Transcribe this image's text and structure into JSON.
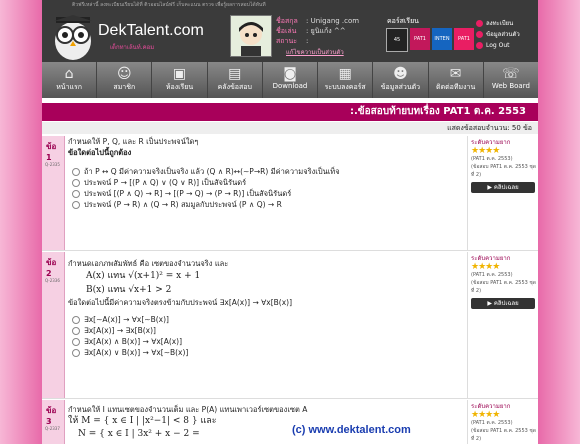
{
  "top_strip": "ติวฟรีเหล่านี้ ลงทะเบียนเรียนได้ที่ ติวออนไลน์ฟรี เก็บคะแนน ตรวจ เพื่อรู้ผลการสอบได้ทันที",
  "brand": {
    "name": "DekTalent.com",
    "tagline": "เด็กทาเล้นท์.คอม"
  },
  "user": {
    "name_label": "ชื่อสกุล",
    "name_value": "Unigang .com",
    "alias_label": "ชื่อเล่น",
    "alias_value": "ยูนิแก้ง ^^",
    "status_label": "สถานะ",
    "status_value": "",
    "edit_link": "แก้ไขความเป็นส่วนตัว"
  },
  "courses": {
    "title": "คอร์สเรียน",
    "items": [
      "45",
      "PAT1",
      "INTEN",
      "PAT1"
    ]
  },
  "side_links": [
    "ลงทะเบียน",
    "ข้อมูลส่วนตัว",
    "Log Out"
  ],
  "nav": [
    {
      "label": "หน้าแรก",
      "icon": "house-icon"
    },
    {
      "label": "สมาชิก",
      "icon": "member-icon"
    },
    {
      "label": "ห้องเรียน",
      "icon": "classroom-icon"
    },
    {
      "label": "คลังข้อสอบ",
      "icon": "exam-bank-icon"
    },
    {
      "label": "Download",
      "icon": "download-icon"
    },
    {
      "label": "ระบบลงคอร์ส",
      "icon": "course-system-icon"
    },
    {
      "label": "ข้อมูลส่วนตัว",
      "icon": "profile-icon"
    },
    {
      "label": "ติดต่อทีมงาน",
      "icon": "contact-icon"
    },
    {
      "label": "Web Board",
      "icon": "webboard-icon"
    }
  ],
  "page_title": ":.ข้อสอบท้ายบทเรื่อง PAT1 ต.ค. 2553",
  "count_text": "แสดงข้อสอบจำนวน: 50 ข้อ",
  "questions": [
    {
      "num": "ข้อ 1",
      "code": "Q-2335",
      "lines": [
        "กำหนดให้ P, Q, และ R เป็นประพจน์ใดๆ",
        "ข้อใดต่อไปนี้ถูกต้อง"
      ],
      "options": [
        "ถ้า P ↔ Q มีค่าความจริงเป็นจริง แล้ว (Q ∧ R)↔(∼P→R) มีค่าความจริงเป็นเท็จ",
        "ประพจน์ P → [(P ∧ Q) ∨ (Q ∨ R)] เป็นสัจนิรันดร์",
        "ประพจน์ [(P ∧ Q) → R] → [(P → Q) → (P → R)] เป็นสัจนิรันดร์",
        "ประพจน์ (P → R) ∧ (Q → R) สมมูลกับประพจน์ (P ∧ Q) → R"
      ],
      "side": {
        "head": "ระดับความยาก",
        "stars": "★★★★",
        "info1": "(PAT1 ต.ค. 2553)",
        "info2": "(ข้อสอบ PAT1 ต.ค. 2553 ชุดที่ 2)",
        "button": "คลิปเฉลย"
      }
    },
    {
      "num": "ข้อ 2",
      "code": "Q-2336",
      "lines": [
        "กำหนดเอกภพสัมพัทธ์ คือ เซตของจำนวนจริง และ",
        "A(x) แทน √(x+1)² = x + 1",
        "B(x) แทน √x+1 > 2",
        "ข้อใดต่อไปนี้มีค่าความจริงตรงข้ามกับประพจน์ ∃x[A(x)] → ∀x[B(x)]"
      ],
      "options": [
        "∃x[∼A(x)] → ∀x[∼B(x)]",
        "∃x[A(x)] → ∃x[B(x)]",
        "∃x[A(x) ∧ B(x)] → ∀x[A(x)]",
        "∃x[A(x) ∨ B(x)] → ∀x[∼B(x)]"
      ],
      "side": {
        "head": "ระดับความยาก",
        "stars": "★★★★",
        "info1": "(PAT1 ต.ค. 2553)",
        "info2": "(ข้อสอบ PAT1 ต.ค. 2553 ชุดที่ 2)",
        "button": "คลิปเฉลย"
      }
    },
    {
      "num": "ข้อ 3",
      "code": "Q-2337",
      "lines": [
        "กำหนดให้ I แทนเซตของจำนวนเต็ม และ P(A) แทนเพาเวอร์เซตของเซต A",
        "ให้ M = { x ∈ I | |x²−1| < 8 } และ",
        "N = { x ∈ I | 3x² + x − 2 ="
      ],
      "options": [],
      "side": {
        "head": "ระดับความยาก",
        "stars": "★★★★",
        "info1": "(PAT1 ต.ค. 2553)",
        "info2": "(ข้อสอบ PAT1 ต.ค. 2553 ชุดที่ 2)",
        "button": ""
      }
    }
  ],
  "watermark": "(c) www.dektalent.com"
}
